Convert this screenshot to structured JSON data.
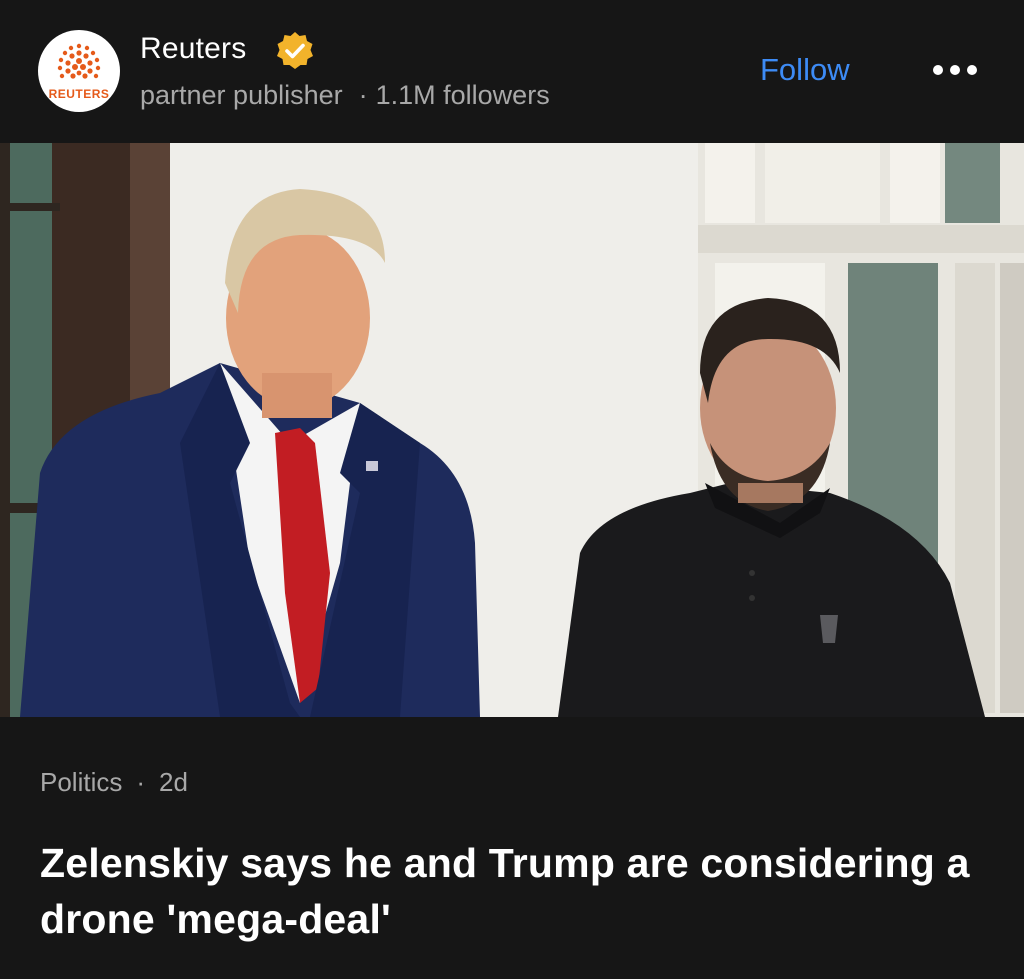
{
  "publisher": {
    "name": "Reuters",
    "logo_text": "REUTERS",
    "verified_icon": "verified-badge-icon",
    "role": "partner publisher",
    "separator": "·",
    "followers": "1.1M followers"
  },
  "actions": {
    "follow_label": "Follow",
    "more_icon": "more-options-icon"
  },
  "article": {
    "category": "Politics",
    "separator": "·",
    "age": "2d",
    "headline": "Zelenskiy says he and Trump are considering a drone 'mega-deal'"
  },
  "colors": {
    "background": "#161616",
    "accent": "#3d8bf5",
    "verified": "#f2b32b",
    "muted_text": "#a8a8a8",
    "logo_orange": "#e55a1a"
  }
}
